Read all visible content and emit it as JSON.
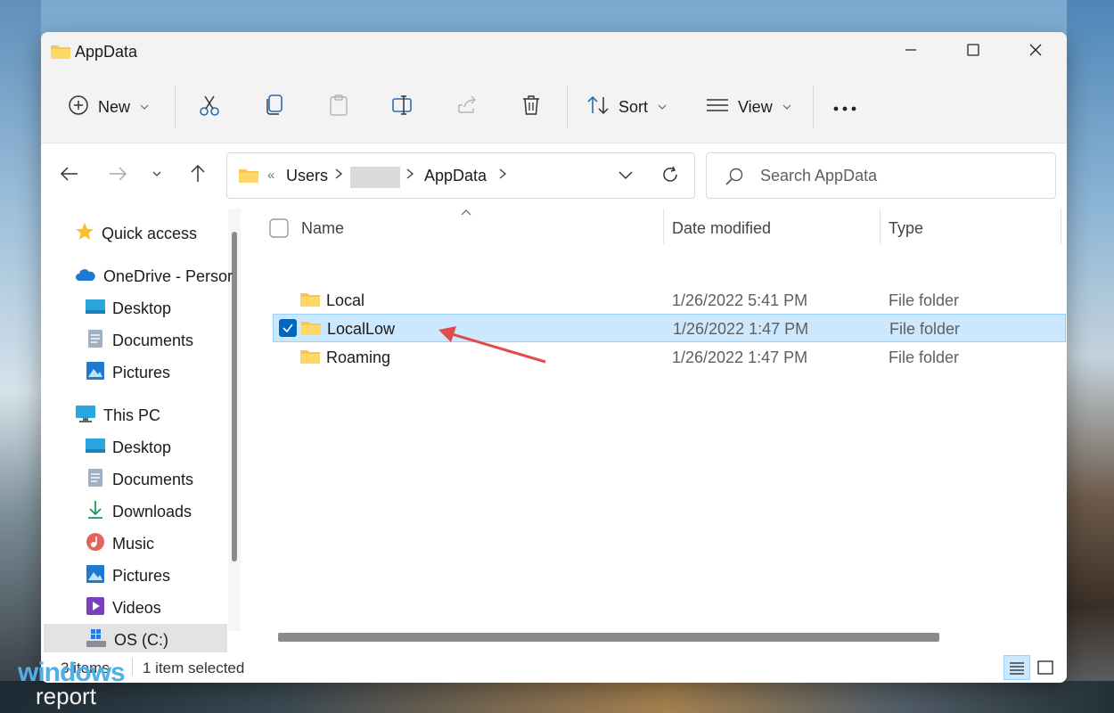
{
  "window": {
    "title": "AppData"
  },
  "toolbar": {
    "new_label": "New",
    "sort_label": "Sort",
    "view_label": "View"
  },
  "address": {
    "overflow": "«",
    "crumbs": [
      "Users",
      "AppData"
    ]
  },
  "search": {
    "placeholder": "Search AppData"
  },
  "sidebar": {
    "items": [
      "Quick access",
      "OneDrive - Persor",
      "Desktop",
      "Documents",
      "Pictures",
      "This PC",
      "Desktop",
      "Documents",
      "Downloads",
      "Music",
      "Pictures",
      "Videos",
      "OS (C:)"
    ]
  },
  "columns": {
    "name": "Name",
    "date": "Date modified",
    "type": "Type"
  },
  "files": [
    {
      "name": "Local",
      "date": "1/26/2022 5:41 PM",
      "type": "File folder"
    },
    {
      "name": "LocalLow",
      "date": "1/26/2022 1:47 PM",
      "type": "File folder",
      "selected": true
    },
    {
      "name": "Roaming",
      "date": "1/26/2022 1:47 PM",
      "type": "File folder"
    }
  ],
  "status": {
    "count": "3 items",
    "selection": "1 item selected"
  },
  "watermark": {
    "line1": "windows",
    "line2": "report"
  },
  "colors": {
    "selection": "#cce8ff",
    "accent": "#0067c0",
    "annotation_arrow": "#e24b4b",
    "folder": "#f8c84a"
  }
}
